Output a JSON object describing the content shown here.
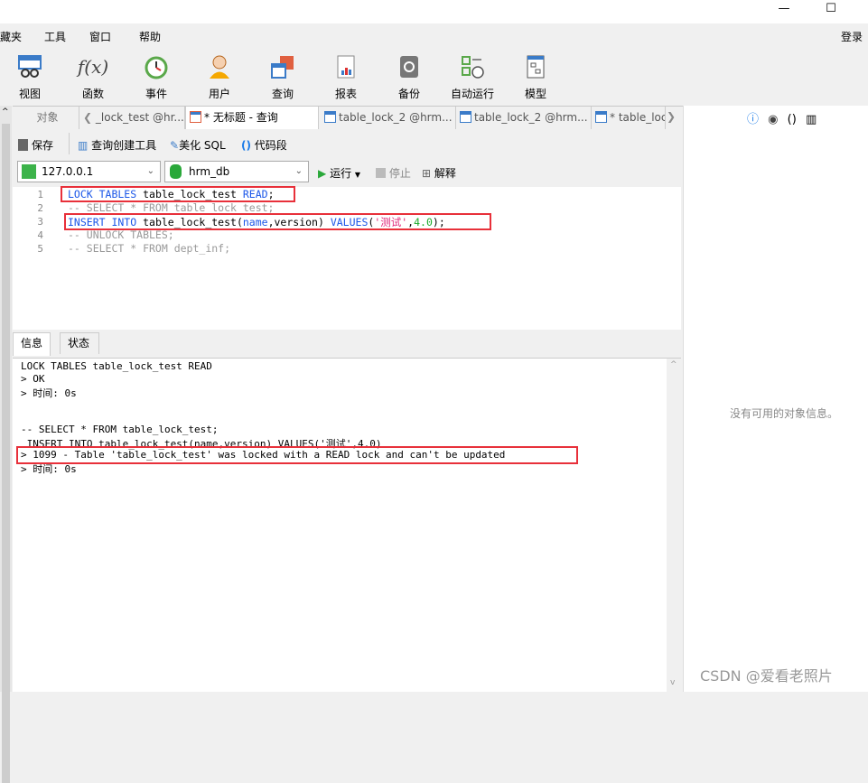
{
  "window": {
    "minimize": "—",
    "maximize": "☐",
    "login": "登录"
  },
  "menu": [
    "藏夹",
    "工具",
    "窗口",
    "帮助"
  ],
  "toolbar": [
    {
      "label": "视图",
      "icon": "view-icon"
    },
    {
      "label": "函数",
      "icon": "function-icon"
    },
    {
      "label": "事件",
      "icon": "event-clock-icon"
    },
    {
      "label": "用户",
      "icon": "user-icon"
    },
    {
      "label": "查询",
      "icon": "query-icon"
    },
    {
      "label": "报表",
      "icon": "report-icon"
    },
    {
      "label": "备份",
      "icon": "backup-icon"
    },
    {
      "label": "自动运行",
      "icon": "auto-run-icon"
    },
    {
      "label": "模型",
      "icon": "model-icon"
    }
  ],
  "tabs": {
    "objects": "对象",
    "items": [
      "_lock_test @hr...",
      "* 无标题 - 查询",
      "table_lock_2 @hrm...",
      "table_lock_2 @hrm...",
      "* table_loc"
    ]
  },
  "query_toolbar": {
    "save": "保存",
    "builder": "查询创建工具",
    "beautify": "美化 SQL",
    "snippet": "代码段"
  },
  "connection": {
    "host": "127.0.0.1",
    "database": "hrm_db",
    "run": "运行",
    "stop": "停止",
    "explain": "解释"
  },
  "editor": {
    "line_numbers": [
      "1",
      "2",
      "3",
      "4",
      "5"
    ],
    "lines": [
      [
        {
          "t": "LOCK TABLES",
          "c": "kw"
        },
        {
          "t": " table_lock_test ",
          "c": ""
        },
        {
          "t": "READ",
          "c": "kw"
        },
        {
          "t": ";",
          "c": ""
        }
      ],
      [
        {
          "t": "-- SELECT * FROM table_lock_test;",
          "c": "cm"
        }
      ],
      [
        {
          "t": "INSERT INTO",
          "c": "kw"
        },
        {
          "t": " table_lock_test(",
          "c": ""
        },
        {
          "t": "name",
          "c": "kw"
        },
        {
          "t": ",version) ",
          "c": ""
        },
        {
          "t": "VALUES",
          "c": "kw"
        },
        {
          "t": "(",
          "c": ""
        },
        {
          "t": "'测试'",
          "c": "str"
        },
        {
          "t": ",",
          "c": ""
        },
        {
          "t": "4.0",
          "c": "num"
        },
        {
          "t": ");",
          "c": ""
        }
      ],
      [
        {
          "t": "-- UNLOCK TABLES;",
          "c": "cm"
        }
      ],
      [
        {
          "t": "-- SELECT * FROM dept_inf;",
          "c": "cm"
        }
      ]
    ]
  },
  "bottom_tabs": [
    "信息",
    "状态"
  ],
  "output": [
    "LOCK TABLES table_lock_test READ",
    "> OK",
    "> 时间: 0s",
    "",
    "",
    "-- SELECT * FROM table_lock_test;",
    " INSERT INTO table_lock_test(name,version) VALUES('测试',4.0)",
    "> 1099 - Table 'table_lock_test' was locked with a READ lock and can't be updated",
    "> 时间: 0s"
  ],
  "right_panel": {
    "empty": "没有可用的对象信息。"
  },
  "watermark": "CSDN @爱看老照片",
  "colors": {
    "highlight": "#e8303a",
    "keyword": "#1a56e8",
    "comment": "#999999",
    "string": "#e0287a",
    "number": "#1aaa2a"
  }
}
